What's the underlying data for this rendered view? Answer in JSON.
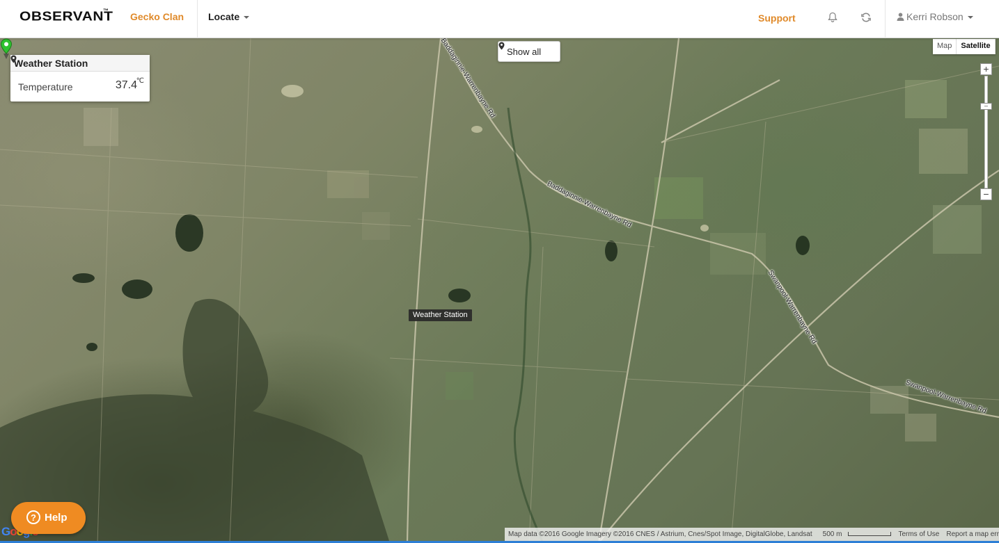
{
  "nav": {
    "logo": "OBSERVANT",
    "logo_tm": "™",
    "clan": "Gecko Clan",
    "locate": "Locate",
    "support": "Support",
    "user": "Kerri Robson"
  },
  "map": {
    "show_all": "Show all",
    "map_type": {
      "map": "Map",
      "satellite": "Satellite",
      "active": "Satellite"
    },
    "zoom": {
      "plus": "+",
      "minus": "−"
    },
    "roads": [
      "Baddaginnie-Warrenbayne Rd",
      "Baddaginnie-Warrenbayne Rd",
      "Swanpool-Warrenbayne Rd",
      "Swanpool-Warrenbayne Rd"
    ],
    "marker_label": "Weather Station",
    "marker_color": "#2fc12f"
  },
  "info_panel": {
    "title": "Weather Station",
    "temperature_label": "Temperature",
    "temperature_value": "37.4",
    "temperature_unit": "℃"
  },
  "help": {
    "label": "Help",
    "color": "#ef8b22"
  },
  "attribution": {
    "google": "Google",
    "data": "Map data ©2016 Google Imagery ©2016 CNES / Astrium, Cnes/Spot Image, DigitalGlobe, Landsat",
    "scale": "500 m",
    "terms": "Terms of Use",
    "report": "Report a map error"
  }
}
